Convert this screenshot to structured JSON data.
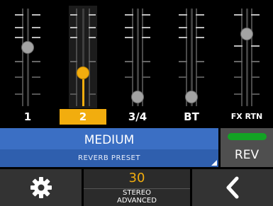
{
  "channels": [
    {
      "label": "1",
      "selected": false,
      "level": 0.6
    },
    {
      "label": "2",
      "selected": true,
      "level": 0.33
    },
    {
      "label": "3/4",
      "selected": false,
      "level": 0.07
    },
    {
      "label": "BT",
      "selected": false,
      "level": 0.07
    },
    {
      "label": "FX RTN",
      "selected": false,
      "level": 0.75
    }
  ],
  "preset": {
    "name": "MEDIUM",
    "subtitle": "REVERB PRESET"
  },
  "effect_toggle": {
    "label": "REV",
    "led_color": "#13a324",
    "on": true
  },
  "parameter": {
    "value": "30",
    "line1": "STEREO",
    "line2": "ADVANCED"
  },
  "colors": {
    "accent": "#f2ad0e",
    "preset_bg": "#3b6fc4"
  },
  "icons": {
    "settings": "gear-icon",
    "back": "chevron-left-icon"
  }
}
